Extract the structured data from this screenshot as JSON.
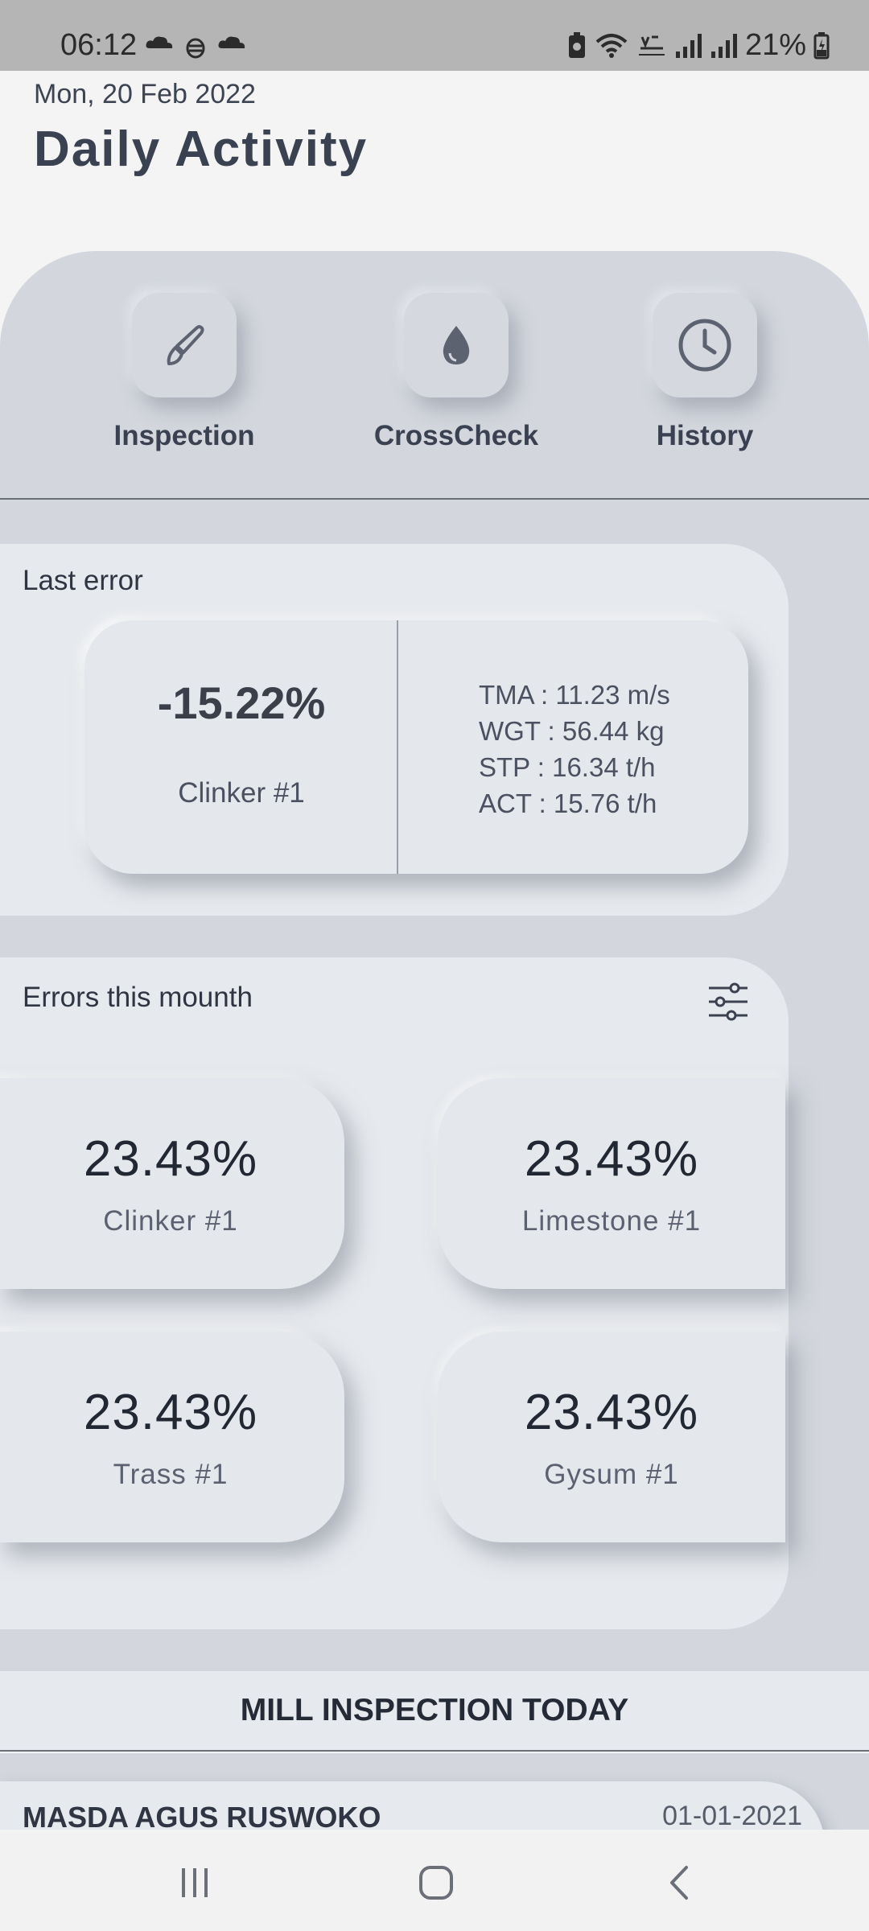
{
  "status_bar": {
    "time": "06:12",
    "battery": "21%"
  },
  "header": {
    "date": "Mon, 20 Feb 2022",
    "title": "Daily Activity"
  },
  "nav": [
    {
      "label": "Inspection",
      "icon": "brush-icon"
    },
    {
      "label": "CrossCheck",
      "icon": "drop-icon"
    },
    {
      "label": "History",
      "icon": "clock-icon"
    }
  ],
  "last_error": {
    "title": "Last error",
    "value": "-15.22%",
    "material": "Clinker #1",
    "details": [
      "TMA : 11.23 m/s",
      "WGT : 56.44 kg",
      "STP : 16.34 t/h",
      "ACT : 15.76 t/h"
    ]
  },
  "errors_month": {
    "title": "Errors this mounth",
    "items": [
      {
        "value": "23.43%",
        "label": "Clinker #1"
      },
      {
        "value": "23.43%",
        "label": "Limestone #1"
      },
      {
        "value": "23.43%",
        "label": "Trass #1"
      },
      {
        "value": "23.43%",
        "label": "Gysum #1"
      }
    ]
  },
  "mill_inspection": {
    "title": "MILL INSPECTION TODAY",
    "items": [
      {
        "name": "MASDA AGUS RUSWOKO",
        "date": "01-01-2021"
      }
    ]
  },
  "colors": {
    "panel": "#d3d6dd",
    "card": "#e6e9ed",
    "text": "#3a4150"
  }
}
